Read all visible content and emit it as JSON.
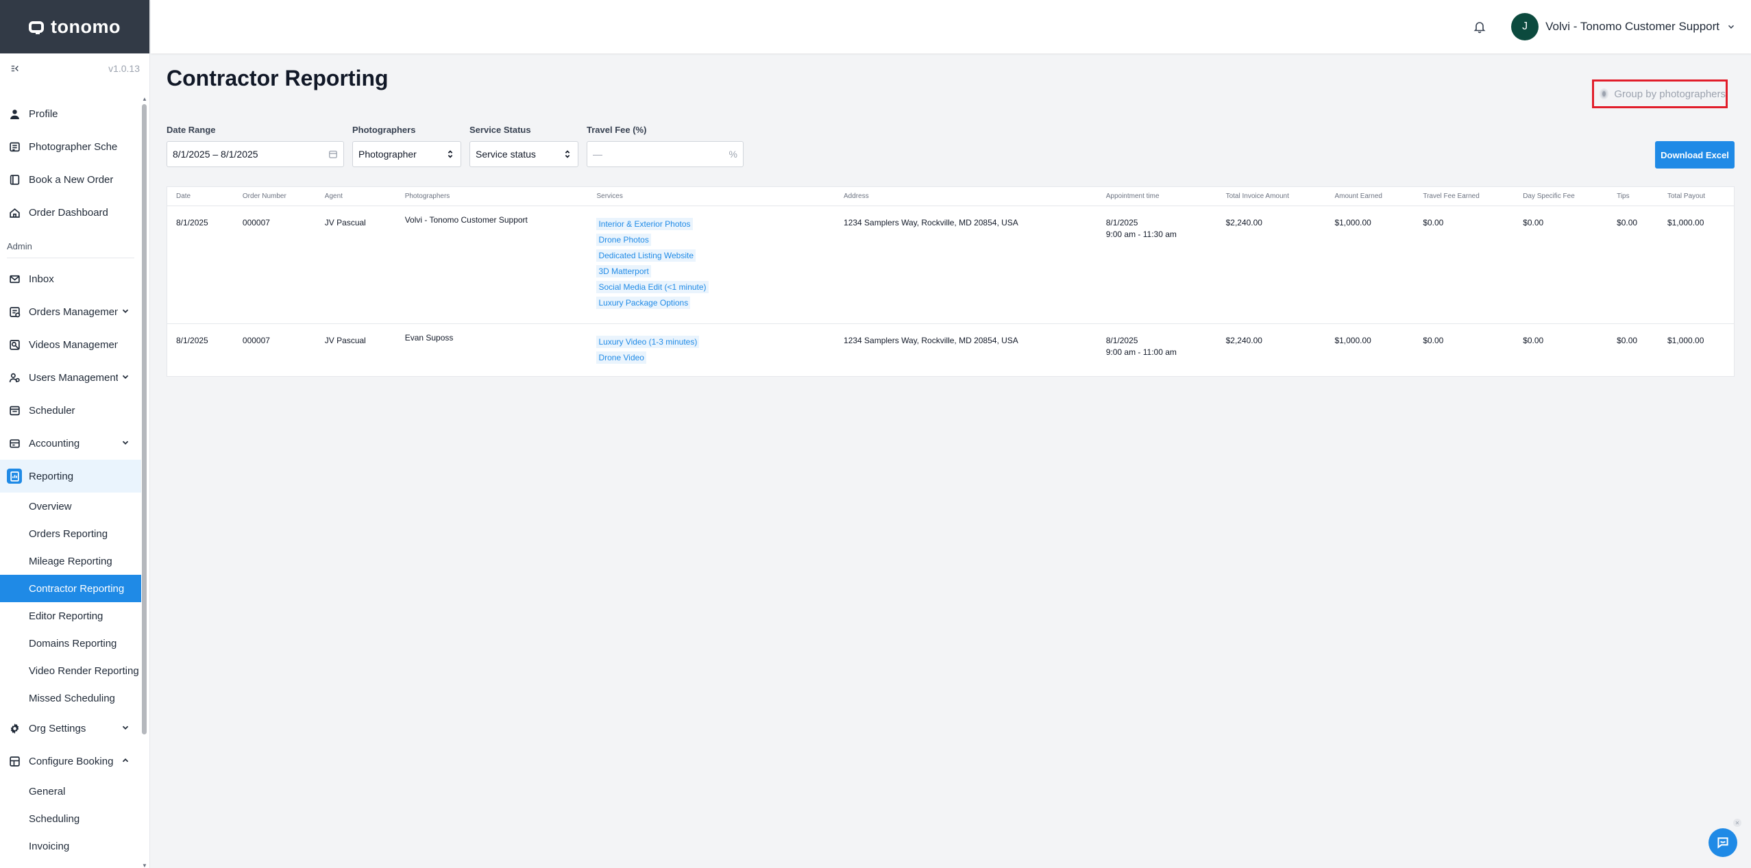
{
  "brand": {
    "name": "tonomo",
    "version": "v1.0.13"
  },
  "header": {
    "avatar_initial": "J",
    "user_name": "Volvi - Tonomo Customer Support"
  },
  "sidebar": {
    "items_top": [
      {
        "label": "Profile",
        "icon": "user-icon"
      },
      {
        "label": "Photographer Schedule",
        "icon": "calendar-icon"
      },
      {
        "label": "Book a New Order",
        "icon": "book-icon"
      },
      {
        "label": "Order Dashboard",
        "icon": "home-icon"
      }
    ],
    "admin_label": "Admin",
    "items_admin": [
      {
        "label": "Inbox",
        "icon": "mail-icon"
      },
      {
        "label": "Orders Management",
        "icon": "orders-icon",
        "chevron": "down"
      },
      {
        "label": "Videos Management",
        "icon": "video-icon"
      },
      {
        "label": "Users Management",
        "icon": "users-icon",
        "chevron": "down"
      },
      {
        "label": "Scheduler",
        "icon": "scheduler-icon"
      },
      {
        "label": "Accounting",
        "icon": "accounting-icon",
        "chevron": "down"
      }
    ],
    "reporting": {
      "label": "Reporting",
      "sub_items": [
        "Overview",
        "Orders Reporting",
        "Mileage Reporting",
        "Contractor Reporting",
        "Editor Reporting",
        "Domains Reporting",
        "Video Render Reporting",
        "Missed Scheduling"
      ],
      "active": "Contractor Reporting"
    },
    "org_settings": "Org Settings",
    "configure_booking": {
      "label": "Configure Booking",
      "sub_items": [
        "General",
        "Scheduling",
        "Invoicing"
      ]
    }
  },
  "page": {
    "title": "Contractor Reporting",
    "group_toggle_label": "Group by photographers",
    "download_label": "Download Excel"
  },
  "filters": {
    "date_range": {
      "label": "Date Range",
      "value": "8/1/2025 – 8/1/2025"
    },
    "photographers": {
      "label": "Photographers",
      "value": "Photographer"
    },
    "service_status": {
      "label": "Service Status",
      "value": "Service status"
    },
    "travel_fee": {
      "label": "Travel Fee (%)",
      "placeholder": "—",
      "suffix": "%"
    }
  },
  "table": {
    "columns": [
      "Date",
      "Order Number",
      "Agent",
      "Photographers",
      "Services",
      "Address",
      "Appointment time",
      "Total Invoice Amount",
      "Amount Earned",
      "Travel Fee Earned",
      "Day Specific Fee",
      "Tips",
      "Total Payout"
    ],
    "rows": [
      {
        "date": "8/1/2025",
        "order": "000007",
        "agent": "JV Pascual",
        "photographer": "Volvi - Tonomo Customer Support",
        "services": [
          "Interior & Exterior Photos",
          "Drone Photos",
          "Dedicated Listing Website",
          "3D Matterport",
          "Social Media Edit (<1 minute)",
          "Luxury Package Options"
        ],
        "address": "1234 Samplers Way, Rockville, MD 20854, USA",
        "appt_date": "8/1/2025",
        "appt_time": "9:00 am - 11:30 am",
        "invoice": "$2,240.00",
        "earned": "$1,000.00",
        "travel": "$0.00",
        "day_fee": "$0.00",
        "tips": "$0.00",
        "payout": "$1,000.00"
      },
      {
        "date": "8/1/2025",
        "order": "000007",
        "agent": "JV Pascual",
        "photographer": "Evan Suposs",
        "services": [
          "Luxury Video (1-3 minutes)",
          "Drone Video"
        ],
        "address": "1234 Samplers Way, Rockville, MD 20854, USA",
        "appt_date": "8/1/2025",
        "appt_time": "9:00 am - 11:00 am",
        "invoice": "$2,240.00",
        "earned": "$1,000.00",
        "travel": "$0.00",
        "day_fee": "$0.00",
        "tips": "$0.00",
        "payout": "$1,000.00"
      }
    ]
  },
  "colors": {
    "accent": "#1f8ae6",
    "sidebar_brand_bg": "#323a46",
    "highlight_border": "#e11d2a",
    "avatar_bg": "#0c4a3e"
  }
}
